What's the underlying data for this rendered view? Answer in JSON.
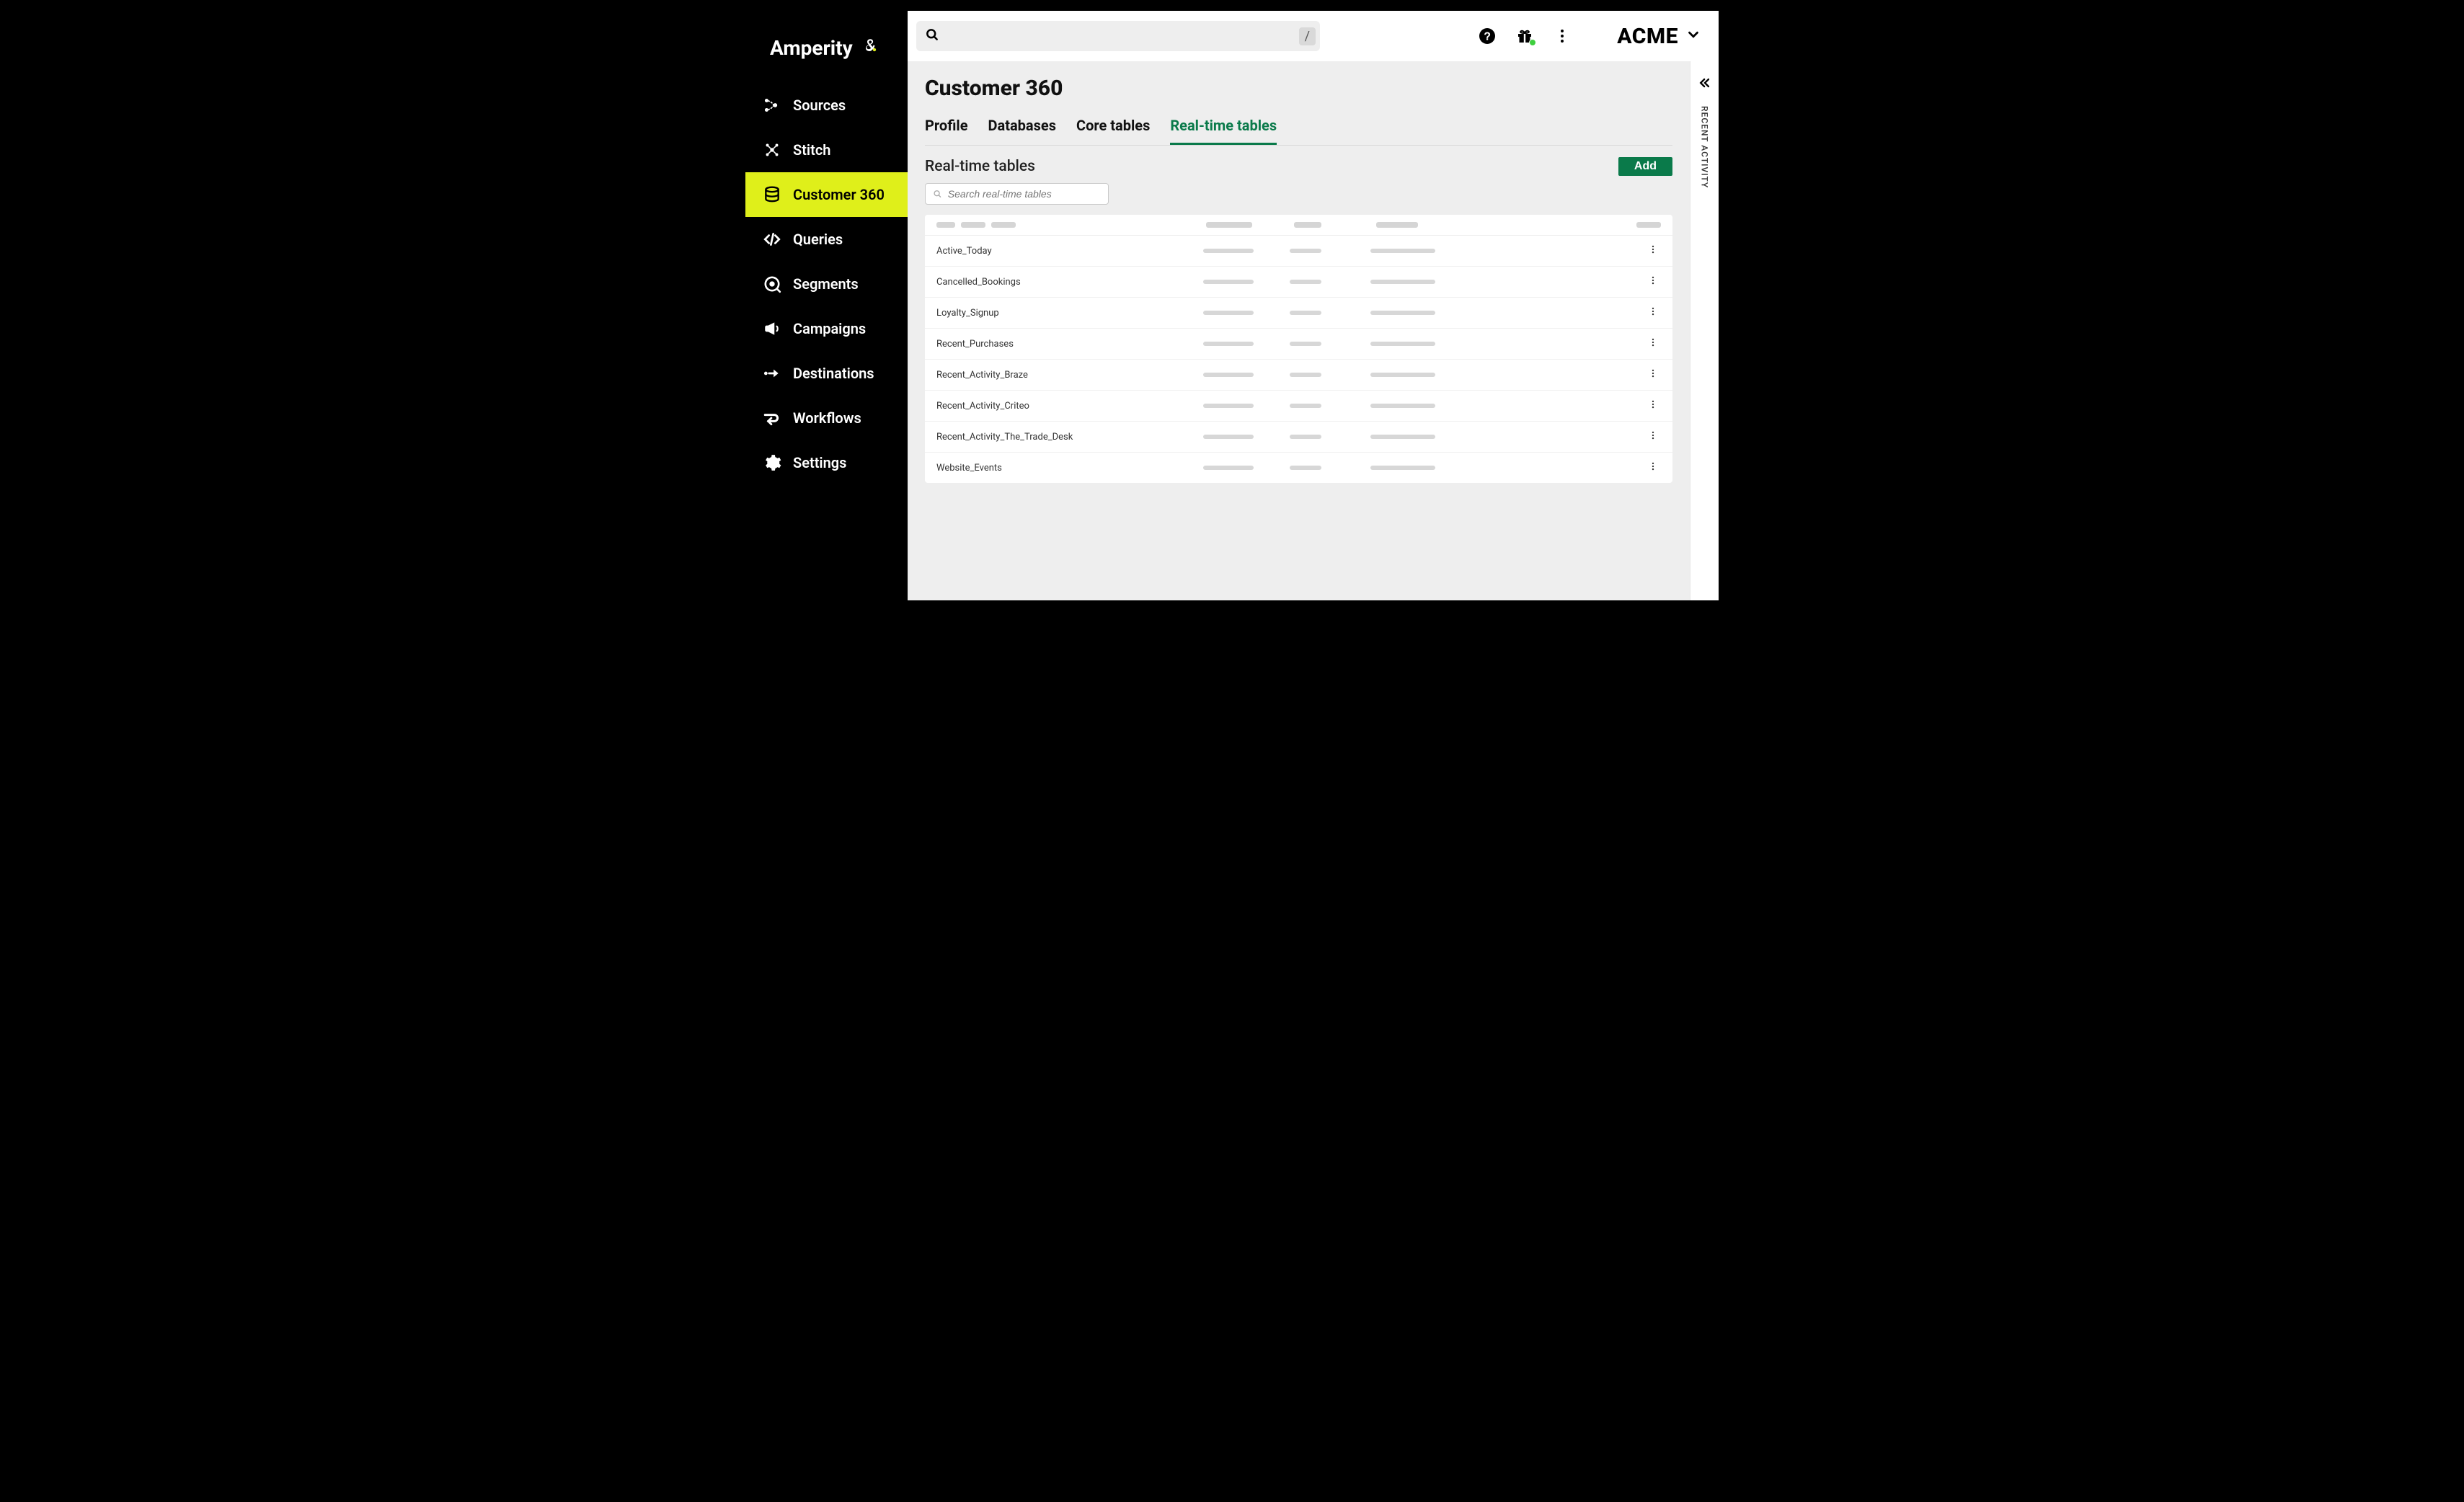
{
  "brand": {
    "name": "Amperity"
  },
  "sidebar": {
    "items": [
      {
        "label": "Sources"
      },
      {
        "label": "Stitch"
      },
      {
        "label": "Customer 360"
      },
      {
        "label": "Queries"
      },
      {
        "label": "Segments"
      },
      {
        "label": "Campaigns"
      },
      {
        "label": "Destinations"
      },
      {
        "label": "Workflows"
      },
      {
        "label": "Settings"
      }
    ],
    "active_index": 2
  },
  "topbar": {
    "search_placeholder": "",
    "slash_hint": "/",
    "org_name": "ACME"
  },
  "page": {
    "title": "Customer 360",
    "tabs": [
      "Profile",
      "Databases",
      "Core tables",
      "Real-time tables"
    ],
    "active_tab_index": 3,
    "section_title": "Real-time tables",
    "add_label": "Add",
    "filter_placeholder": "Search real-time tables",
    "rows": [
      {
        "name": "Active_Today"
      },
      {
        "name": "Cancelled_Bookings"
      },
      {
        "name": "Loyalty_Signup"
      },
      {
        "name": "Recent_Purchases"
      },
      {
        "name": "Recent_Activity_Braze"
      },
      {
        "name": "Recent_Activity_Criteo"
      },
      {
        "name": "Recent_Activity_The_Trade_Desk"
      },
      {
        "name": "Website_Events"
      }
    ]
  },
  "right_rail": {
    "label": "RECENT ACTIVITY"
  }
}
